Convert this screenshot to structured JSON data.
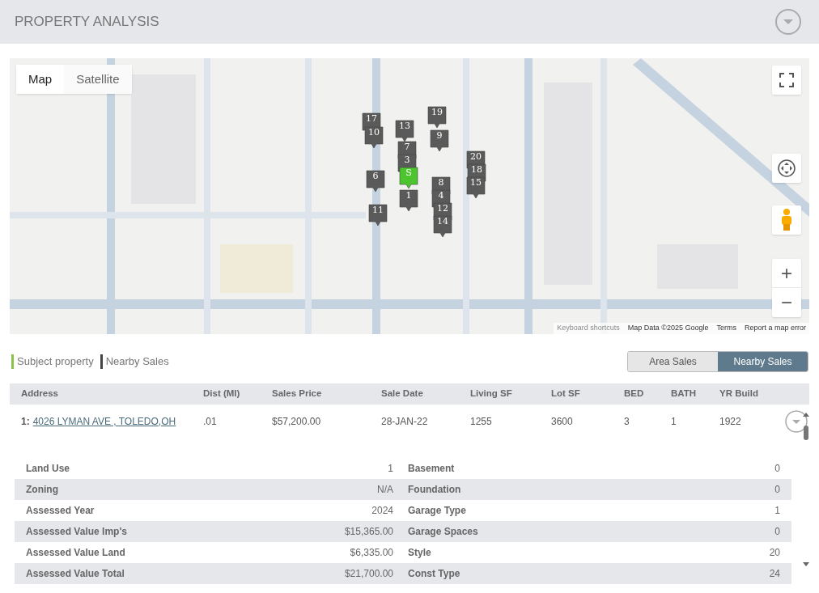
{
  "header": {
    "title": "PROPERTY ANALYSIS"
  },
  "map": {
    "kind": "picture",
    "map_types": [
      {
        "label": "Map",
        "selected": true
      },
      {
        "label": "Satellite",
        "selected": false
      }
    ],
    "markers": [
      {
        "label": "17",
        "kind": "sale"
      },
      {
        "label": "10",
        "kind": "sale"
      },
      {
        "label": "6",
        "kind": "sale"
      },
      {
        "label": "11",
        "kind": "sale"
      },
      {
        "label": "13",
        "kind": "sale"
      },
      {
        "label": "7",
        "kind": "sale"
      },
      {
        "label": "3",
        "kind": "sale"
      },
      {
        "label": "S",
        "kind": "subject"
      },
      {
        "label": "1",
        "kind": "sale"
      },
      {
        "label": "19",
        "kind": "sale"
      },
      {
        "label": "9",
        "kind": "sale"
      },
      {
        "label": "8",
        "kind": "sale"
      },
      {
        "label": "4",
        "kind": "sale"
      },
      {
        "label": "12",
        "kind": "sale"
      },
      {
        "label": "14",
        "kind": "sale"
      },
      {
        "label": "20",
        "kind": "sale"
      },
      {
        "label": "18",
        "kind": "sale"
      },
      {
        "label": "15",
        "kind": "sale"
      }
    ],
    "zoom_in": "+",
    "zoom_out": "−",
    "footer": [
      "Keyboard shortcuts",
      "Map Data ©2025 Google",
      "Terms",
      "Report a map error"
    ]
  },
  "legend": [
    {
      "label": "Subject property",
      "color": "#8bc34a"
    },
    {
      "label": "Nearby Sales",
      "color": "#444444"
    }
  ],
  "view_tabs": [
    {
      "label": "Area Sales",
      "selected": false
    },
    {
      "label": "Nearby Sales",
      "selected": true
    }
  ],
  "table": {
    "columns": [
      "Address",
      "Dist (MI)",
      "Sales Price",
      "Sale Date",
      "Living SF",
      "Lot SF",
      "BED",
      "BATH",
      "YR Build"
    ],
    "rows": [
      {
        "index": "1:",
        "cells": [
          "4026 LYMAN AVE , TOLEDO,OH",
          ".01",
          "$57,200.00",
          "28-JAN-22",
          "1255",
          "3600",
          "3",
          "1",
          "1922"
        ],
        "expanded": true
      }
    ]
  },
  "details": [
    {
      "label": "Land Use",
      "value": "1",
      "label2": "Basement",
      "value2": "0"
    },
    {
      "label": "Zoning",
      "value": "N/A",
      "label2": "Foundation",
      "value2": "0"
    },
    {
      "label": "Assessed Year",
      "value": "2024",
      "label2": "Garage Type",
      "value2": "1"
    },
    {
      "label": "Assessed Value Imp's",
      "value": "$15,365.00",
      "label2": "Garage Spaces",
      "value2": "0"
    },
    {
      "label": "Assessed Value Land",
      "value": "$6,335.00",
      "label2": "Style",
      "value2": "20"
    },
    {
      "label": "Assessed Value Total",
      "value": "$21,700.00",
      "label2": "Const Type",
      "value2": "24"
    }
  ]
}
